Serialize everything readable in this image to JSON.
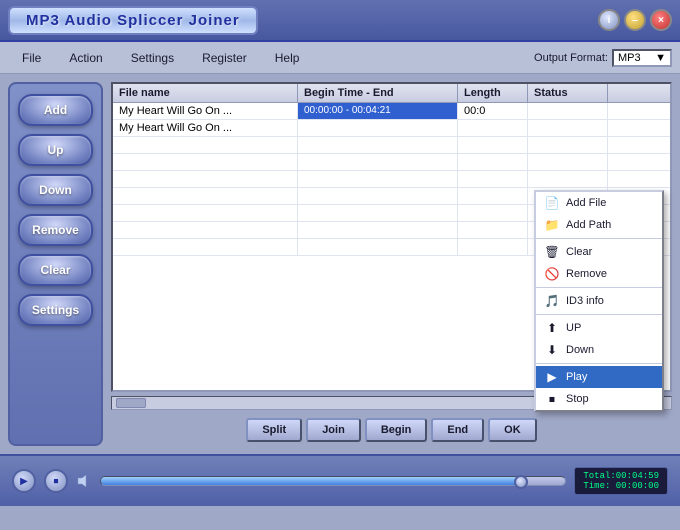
{
  "app": {
    "title": "MP3 Audio Spliccer Joiner",
    "title_buttons": {
      "info": "i",
      "minimize": "–",
      "close": "×"
    }
  },
  "menubar": {
    "items": [
      "File",
      "Action",
      "Settings",
      "Register",
      "Help"
    ],
    "output_format_label": "Output Format:",
    "output_format_value": "MP3"
  },
  "sidebar": {
    "buttons": [
      "Add",
      "Up",
      "Down",
      "Remove",
      "Clear",
      "Settings"
    ]
  },
  "file_table": {
    "headers": [
      "File name",
      "Begin Time - End",
      "Length",
      "Status"
    ],
    "rows": [
      {
        "name": "My Heart Will Go On ...",
        "time": "00:00:00 - 00:04:21",
        "length": "00:0",
        "status": "",
        "selected": false
      },
      {
        "name": "My Heart Will Go On ...",
        "time": "",
        "length": "",
        "status": "",
        "selected": false
      }
    ]
  },
  "action_buttons": [
    "Split",
    "Join",
    "Begin",
    "End",
    "OK"
  ],
  "context_menu": {
    "items": [
      {
        "label": "Add File",
        "icon": "📄",
        "active": false
      },
      {
        "label": "Add Path",
        "icon": "📁",
        "active": false
      },
      {
        "separator_after": true
      },
      {
        "label": "Clear",
        "icon": "🗑",
        "active": false
      },
      {
        "label": "Remove",
        "icon": "🚫",
        "active": false
      },
      {
        "separator_after": true
      },
      {
        "label": "ID3 info",
        "icon": "🎵",
        "active": false
      },
      {
        "separator_after": true
      },
      {
        "label": "UP",
        "icon": "⬆",
        "active": false
      },
      {
        "label": "Down",
        "icon": "⬇",
        "active": false
      },
      {
        "separator_after": true
      },
      {
        "label": "Play",
        "icon": "▶",
        "active": true
      },
      {
        "label": "Stop",
        "icon": "⏹",
        "active": false
      }
    ]
  },
  "player": {
    "play_icon": "▶",
    "stop_icon": "⏹",
    "total_label": "Total:",
    "total_value": "00:04:59",
    "time_label": "Time:",
    "time_value": "00:00:00",
    "progress_percent": 90
  },
  "colors": {
    "accent": "#316ac5",
    "background": "#a0a8c8",
    "sidebar_bg": "#7080c0",
    "title_bg": "#4858a0"
  }
}
